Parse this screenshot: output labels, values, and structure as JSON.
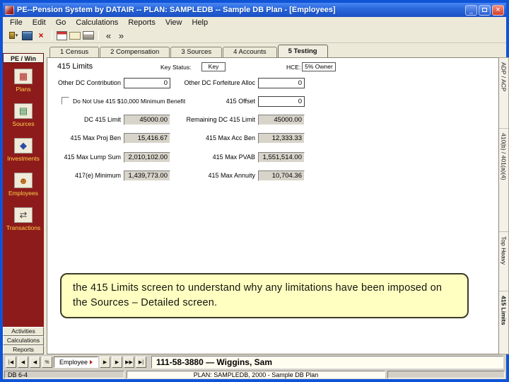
{
  "window": {
    "title": "PE--Pension System by DATAIR -- PLAN: SAMPLEDB -- Sample DB Plan - [Employees]",
    "controls": {
      "minimize": "_",
      "close": "×"
    }
  },
  "menu": {
    "items": [
      "File",
      "Edit",
      "Go",
      "Calculations",
      "Reports",
      "View",
      "Help"
    ]
  },
  "toolbar": {
    "dropdown_glyph": "▾",
    "delete_glyph": "×",
    "back_glyph": "«",
    "forward_glyph": "»"
  },
  "tabs": [
    "1 Census",
    "2 Compensation",
    "3 Sources",
    "4 Accounts",
    "5 Testing"
  ],
  "sidebar": {
    "header": "PE / Win",
    "items": [
      {
        "label": "Plans",
        "glyph": "▦"
      },
      {
        "label": "Sources",
        "glyph": "▤"
      },
      {
        "label": "Investments",
        "glyph": "◆"
      },
      {
        "label": "Employees",
        "glyph": "☻"
      },
      {
        "label": "Transactions",
        "glyph": "⇄"
      }
    ],
    "buttons": [
      "Activities",
      "Calculations",
      "Reports"
    ]
  },
  "right_tabs": [
    "ADP / ACP",
    "410(b) / 401(a)(4)",
    "Top Heavy",
    "415 Limits"
  ],
  "form": {
    "title": "415 Limits",
    "key_status": {
      "label": "Key Status:",
      "value": "Key"
    },
    "hce": {
      "label": "HCE:",
      "value": "5% Owner"
    },
    "checkbox_label": "Do Not Use 415 $10,000 Minimum Benefit",
    "left": [
      {
        "label": "Other DC Contribution",
        "value": "0"
      },
      {
        "label": "DC 415 Limit",
        "value": "45000.00"
      },
      {
        "label": "415 Max Proj Ben",
        "value": "15,416.67"
      },
      {
        "label": "415 Max Lump Sum",
        "value": "2,010,102.00"
      },
      {
        "label": "417(e) Minimum",
        "value": "1,439,773.00"
      }
    ],
    "right": [
      {
        "label": "Other DC Forfeiture Alloc",
        "value": "0"
      },
      {
        "label": "415 Offset",
        "value": "0"
      },
      {
        "label": "Remaining DC 415 Limit",
        "value": "45000.00"
      },
      {
        "label": "415 Max Acc Ben",
        "value": "12,333.33"
      },
      {
        "label": "415 Max PVAB",
        "value": "1,551,514.00"
      },
      {
        "label": "415 Max Annuity",
        "value": "10,704.36"
      }
    ]
  },
  "callout": {
    "text": "the 415 Limits screen to understand why any limitations have been imposed on the Sources – Detailed screen."
  },
  "record_nav": {
    "left": [
      "|◀",
      "◀",
      "◀",
      "%"
    ],
    "employee_label": "Employee",
    "right": [
      "▶",
      "▶",
      "▶▶",
      "▶|"
    ],
    "record": "111-58-3880 — Wiggins, Sam"
  },
  "status_bar": {
    "left": "DB 6-4",
    "plan": "PLAN: SAMPLEDB, 2000 - Sample DB Plan"
  }
}
